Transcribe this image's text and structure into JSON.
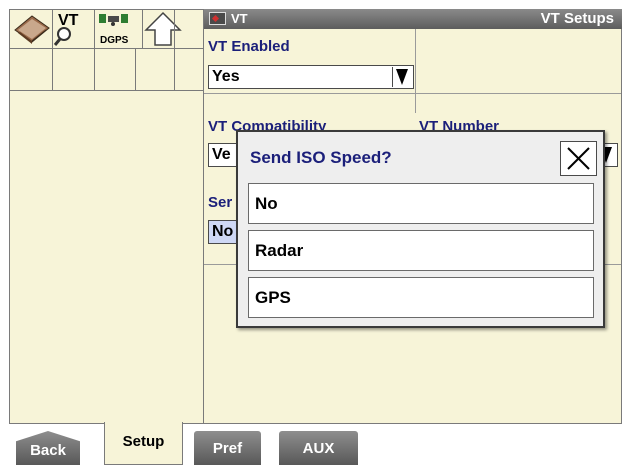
{
  "toolbar": {
    "icons": [
      {
        "name": "book-icon"
      },
      {
        "name": "vt-search-icon",
        "label": "VT"
      },
      {
        "name": "dgps-icon",
        "label": "DGPS"
      },
      {
        "name": "up-arrow-icon"
      }
    ]
  },
  "title_bar": {
    "vt_label": "VT",
    "title": "VT Setups"
  },
  "fields": {
    "vt_enabled": {
      "label": "VT Enabled",
      "value": "Yes"
    },
    "vt_compatibility": {
      "label": "VT Compatibility",
      "value_partial": "Ve"
    },
    "vt_number": {
      "label": "VT Number"
    },
    "send_speed": {
      "label_partial": "Ser",
      "value_partial": "No"
    }
  },
  "popup": {
    "title": "Send ISO Speed?",
    "options": [
      "No",
      "Radar",
      "GPS"
    ]
  },
  "tabs": [
    {
      "label": "Back"
    },
    {
      "label": "Setup",
      "active": true
    },
    {
      "label": "Pref"
    },
    {
      "label": "AUX"
    }
  ]
}
